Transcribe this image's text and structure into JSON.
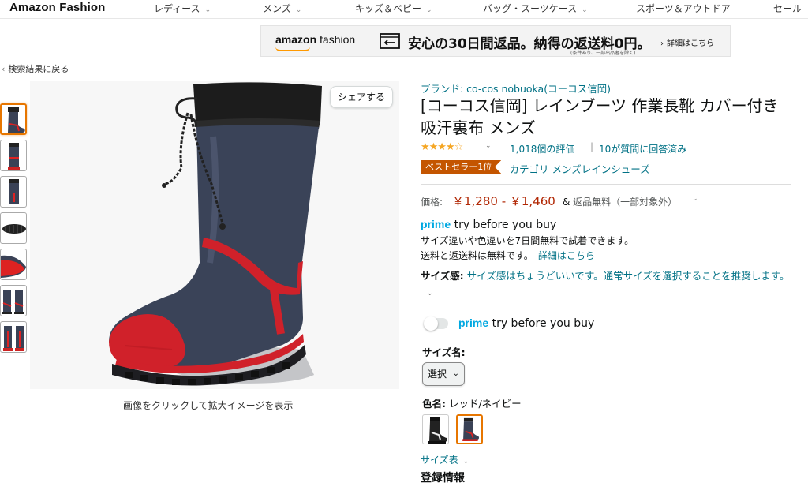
{
  "header": {
    "logo": "Amazon Fashion",
    "nav": [
      {
        "label": "レディース"
      },
      {
        "label": "メンズ"
      },
      {
        "label": "キッズ＆ベビー"
      },
      {
        "label": "バッグ・スーツケース"
      },
      {
        "label": "スポーツ＆アウトドア"
      },
      {
        "label": "セール"
      }
    ]
  },
  "banner": {
    "logo_a": "amazon",
    "logo_b": " fashion",
    "headline": "安心の30日間返品。納得の返送料0円。",
    "subnote": "(条件あり、一部出品者を除く)",
    "link": "詳細はこちら"
  },
  "back_link": "検索結果に戻る",
  "gallery": {
    "share": "シェアする",
    "caption": "画像をクリックして拡大イメージを表示"
  },
  "product": {
    "brand": "ブランド: co-cos nobuoka(コーコス信岡)",
    "title": "[コーコス信岡] レインブーツ 作業長靴 カバー付き 吸汗裏布 メンズ",
    "rating": 4.0,
    "rating_count": "1,018個の評価",
    "separator": "|",
    "answered": "10が質問に回答済み",
    "bestseller_badge": "ベストセラー1位",
    "bestseller_category": "- カテゴリ メンズレインシューズ",
    "price_label": "価格:",
    "price_value": "￥1,280 - ￥1,460",
    "price_ship_prefix": "& ",
    "price_ship": "返品無料（一部対象外）",
    "prime_word": "prime",
    "prime_tail": " try before you buy",
    "prime_desc1": "サイズ違いや色違いを7日間無料で試着できます。",
    "prime_desc2": "送料と返送料は無料です。",
    "prime_desc2_link": "詳細はこちら",
    "fit_label": "サイズ感:",
    "fit_text": " サイズ感はちょうどいいです。通常サイズを選択することを推奨します。",
    "toggle_prime_word": "prime",
    "toggle_prime_tail": " try before you buy",
    "size_label": "サイズ名:",
    "size_select_value": "選択",
    "color_label": "色名:",
    "color_value": " レッド/ネイビー",
    "size_chart": "サイズ表",
    "reg_info": "登録情報"
  }
}
